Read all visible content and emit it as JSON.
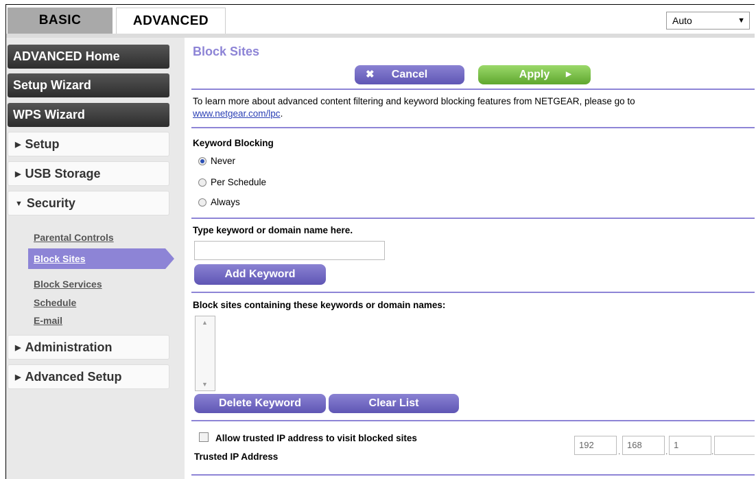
{
  "tabs": {
    "basic": "BASIC",
    "advanced": "ADVANCED"
  },
  "language": {
    "selected": "Auto"
  },
  "sidebar": {
    "advanced_home": "ADVANCED Home",
    "setup_wizard": "Setup Wizard",
    "wps_wizard": "WPS Wizard",
    "menu": [
      {
        "label": "Setup",
        "state": "collapsed"
      },
      {
        "label": "USB Storage",
        "state": "collapsed"
      },
      {
        "label": "Security",
        "state": "expanded"
      },
      {
        "label": "Administration",
        "state": "collapsed"
      },
      {
        "label": "Advanced Setup",
        "state": "collapsed"
      }
    ],
    "security_items": [
      "Parental Controls",
      "Block Sites",
      "Block Services",
      "Schedule",
      "E-mail"
    ],
    "active_item": "Block Sites"
  },
  "main": {
    "title": "Block Sites",
    "cancel_label": "Cancel",
    "apply_label": "Apply",
    "info_text": "To learn more about advanced content filtering and keyword blocking features from NETGEAR, please go to",
    "info_link": "www.netgear.com/lpc",
    "info_end": ".",
    "keyword_blocking": {
      "heading": "Keyword Blocking",
      "options": [
        "Never",
        "Per Schedule",
        "Always"
      ],
      "selected": "Never"
    },
    "keyword_input": {
      "label": "Type keyword or domain name here.",
      "value": ""
    },
    "add_keyword_label": "Add Keyword",
    "blocklist_heading": "Block sites containing these keywords or domain names:",
    "delete_keyword_label": "Delete Keyword",
    "clear_list_label": "Clear List",
    "allow_trusted_label": "Allow trusted IP address to visit blocked sites",
    "allow_trusted_checked": false,
    "trusted_ip_label": "Trusted IP Address",
    "trusted_ip": [
      "192",
      "168",
      "1",
      ""
    ]
  },
  "colors": {
    "accent": "#8d84d6",
    "apply": "#6fb63c",
    "dark_button": "#333333"
  }
}
